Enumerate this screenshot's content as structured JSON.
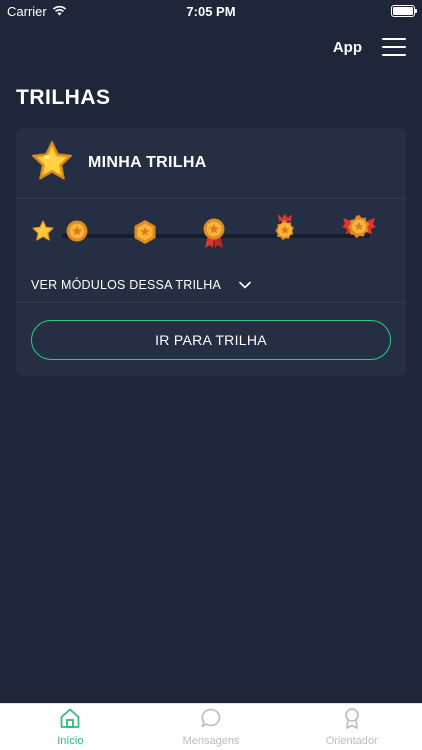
{
  "status_bar": {
    "carrier": "Carrier",
    "time": "7:05 PM"
  },
  "header": {
    "app_label": "App"
  },
  "page": {
    "title": "TRILHAS"
  },
  "trail_card": {
    "title": "MINHA TRILHA",
    "modules_toggle_label": "VER MÓDULOS DESSA TRILHA",
    "go_button_label": "IR PARA TRILHA",
    "badges": [
      "star-icon",
      "bronze-medal-icon",
      "hexagon-badge-icon",
      "ribbon-medal-icon",
      "crowned-medal-icon",
      "winged-medal-icon"
    ]
  },
  "tab_bar": {
    "tabs": [
      {
        "label": "Início",
        "icon": "home-icon",
        "active": true
      },
      {
        "label": "Mensagens",
        "icon": "chat-bubble-icon",
        "active": false
      },
      {
        "label": "Orientador",
        "icon": "award-icon",
        "active": false
      }
    ]
  },
  "colors": {
    "background": "#1f2639",
    "card": "#262e43",
    "accent": "#2ecc80",
    "gold": "#f5b82e"
  }
}
